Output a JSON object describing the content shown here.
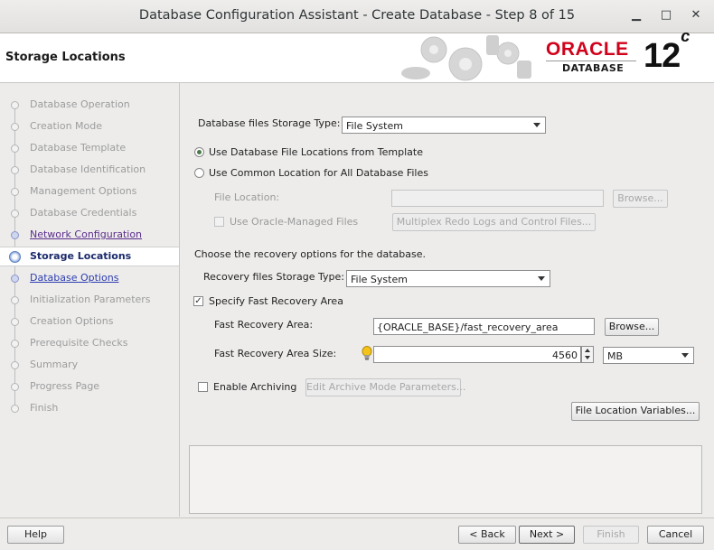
{
  "window": {
    "title": "Database Configuration Assistant - Create Database - Step 8 of 15",
    "minimize_glyph": "▁",
    "maximize_glyph": "□",
    "close_glyph": "✕"
  },
  "header": {
    "title": "Storage Locations",
    "logo_brand": "ORACLE",
    "logo_sub": "DATABASE",
    "logo_version": "12",
    "logo_version_suffix": "c",
    "brand_color": "#d0021b"
  },
  "sidebar": {
    "steps": [
      {
        "label": "Database Operation",
        "state": "disabled"
      },
      {
        "label": "Creation Mode",
        "state": "disabled"
      },
      {
        "label": "Database Template",
        "state": "disabled"
      },
      {
        "label": "Database Identification",
        "state": "disabled"
      },
      {
        "label": "Management Options",
        "state": "disabled"
      },
      {
        "label": "Database Credentials",
        "state": "disabled"
      },
      {
        "label": "Network Configuration",
        "state": "visited"
      },
      {
        "label": "Storage Locations",
        "state": "current"
      },
      {
        "label": "Database Options",
        "state": "link"
      },
      {
        "label": "Initialization Parameters",
        "state": "disabled"
      },
      {
        "label": "Creation Options",
        "state": "disabled"
      },
      {
        "label": "Prerequisite Checks",
        "state": "disabled"
      },
      {
        "label": "Summary",
        "state": "disabled"
      },
      {
        "label": "Progress Page",
        "state": "disabled"
      },
      {
        "label": "Finish",
        "state": "disabled"
      }
    ]
  },
  "main": {
    "db_storage_type_label": "Database files Storage Type:",
    "db_storage_type_value": "File System",
    "radio_template_label": "Use Database File Locations from Template",
    "radio_common_label": "Use Common Location for All Database Files",
    "file_location_label": "File Location:",
    "file_location_value": "",
    "browse_disabled_label": "Browse...",
    "use_omf_label": "Use Oracle-Managed Files",
    "multiplex_label": "Multiplex Redo Logs and Control Files...",
    "recovery_intro": "Choose the recovery options for the database.",
    "recovery_storage_type_label": "Recovery files Storage Type:",
    "recovery_storage_type_value": "File System",
    "specify_fra_label": "Specify Fast Recovery Area",
    "fra_label": "Fast Recovery Area:",
    "fra_value": "{ORACLE_BASE}/fast_recovery_area",
    "fra_browse_label": "Browse...",
    "fra_size_label": "Fast Recovery Area Size:",
    "fra_size_value": "4560",
    "fra_size_unit": "MB",
    "enable_archiving_label": "Enable Archiving",
    "edit_archive_label": "Edit Archive Mode Parameters...",
    "file_location_vars_label": "File Location Variables..."
  },
  "footer": {
    "help_label": "Help",
    "back_label": "< Back",
    "next_label": "Next >",
    "finish_label": "Finish",
    "cancel_label": "Cancel"
  }
}
